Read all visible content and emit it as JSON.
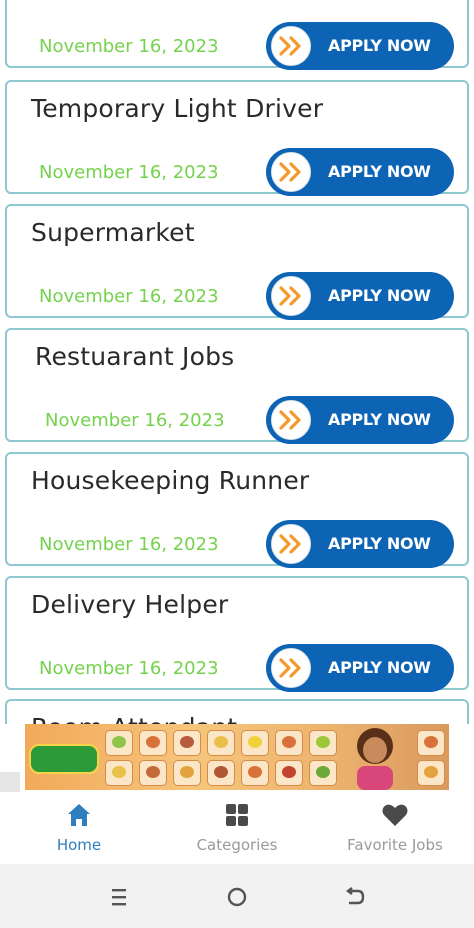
{
  "jobs": [
    {
      "title": "",
      "date": "November 16, 2023",
      "button_label": "APPLY NOW"
    },
    {
      "title": "Temporary Light Driver",
      "date": "November 16, 2023",
      "button_label": "APPLY NOW"
    },
    {
      "title": "Supermarket",
      "date": "November 16, 2023",
      "button_label": "APPLY NOW"
    },
    {
      "title": "Restuarant Jobs",
      "date": "November 16, 2023",
      "button_label": "APPLY NOW"
    },
    {
      "title": "Housekeeping Runner",
      "date": "November 16, 2023",
      "button_label": "APPLY NOW"
    },
    {
      "title": "Delivery Helper",
      "date": "November 16, 2023",
      "button_label": "APPLY NOW"
    },
    {
      "title": "Room Attendant",
      "date": "",
      "button_label": ""
    }
  ],
  "apply_icon": "double-chevron-right-icon",
  "bottom_nav": {
    "items": [
      {
        "label": "Home",
        "icon": "home-icon",
        "active": true
      },
      {
        "label": "Categories",
        "icon": "grid-icon",
        "active": false
      },
      {
        "label": "Favorite Jobs",
        "icon": "heart-icon",
        "active": false
      }
    ]
  },
  "system_nav": {
    "icons": [
      "recents-icon",
      "home-circle-icon",
      "back-icon"
    ]
  },
  "colors": {
    "accent_blue": "#0d64b4",
    "active_nav": "#2f7fc0",
    "date_green": "#75d24d",
    "card_border": "#8fc6cf",
    "chevron_orange": "#f59a2a"
  }
}
